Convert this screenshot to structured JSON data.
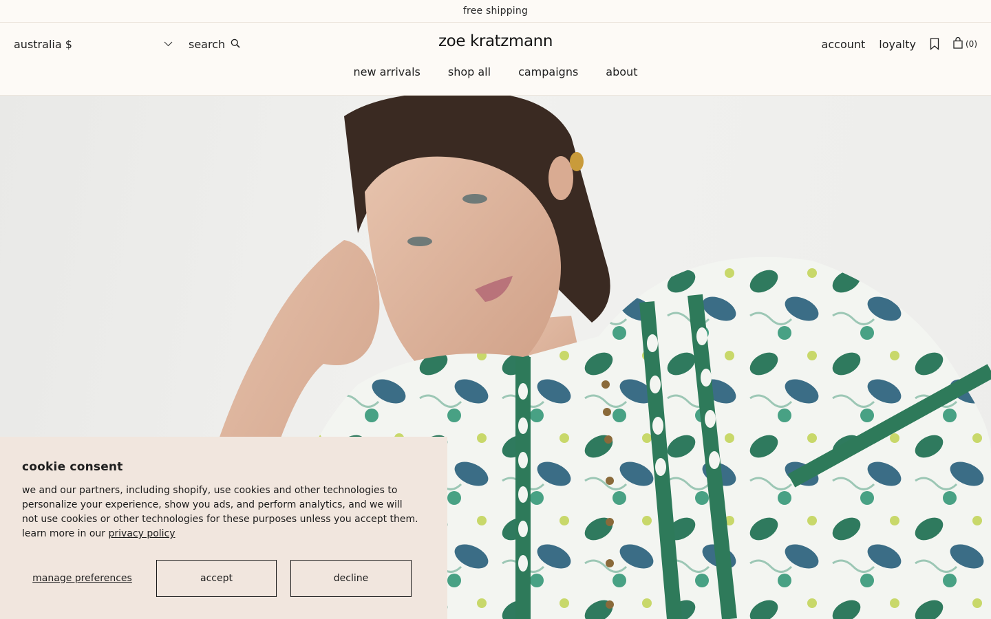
{
  "announcement": {
    "text": "free shipping"
  },
  "header": {
    "region_label": "australia $",
    "search_label": "search",
    "logo": "zoe kratzmann",
    "account_label": "account",
    "loyalty_label": "loyalty",
    "cart_count": "(0)"
  },
  "main_nav": {
    "items": [
      {
        "label": "new arrivals"
      },
      {
        "label": "shop all"
      },
      {
        "label": "campaigns"
      },
      {
        "label": "about"
      }
    ]
  },
  "cookie": {
    "title": "cookie consent",
    "body": "we and our partners, including shopify, use cookies and other technologies to personalize your experience, show you ads, and perform analytics, and we will not use cookies or other technologies for these purposes unless you accept them. learn more in our ",
    "privacy_link": "privacy policy",
    "manage_label": "manage preferences",
    "accept_label": "accept",
    "decline_label": "decline"
  },
  "colors": {
    "page_bg": "#fdfaf6",
    "banner_bg": "#f1e6de",
    "text": "#1f1f1f",
    "dress_green": "#2f7a5e"
  },
  "icons": [
    "chevron-down-icon",
    "search-icon",
    "bookmark-icon",
    "shopping-bag-icon"
  ]
}
